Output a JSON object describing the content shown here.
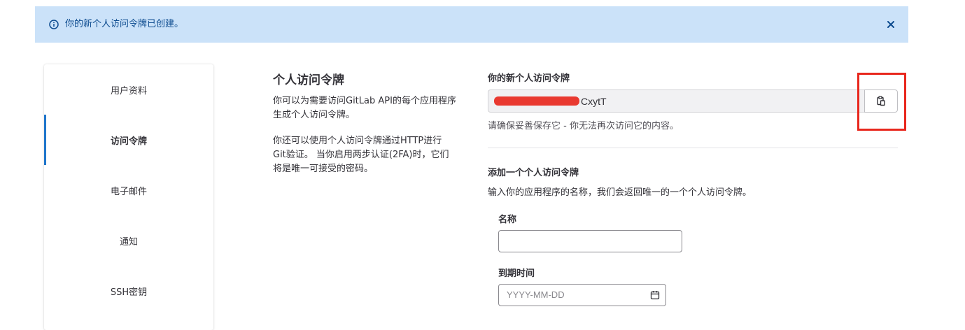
{
  "alert": {
    "message": "你的新个人访问令牌已创建。",
    "info_icon": "info-circle-icon",
    "close_icon": "close-icon",
    "background": "#cbe2f9",
    "text_color": "#0b4a8e"
  },
  "sidebar": {
    "items": [
      {
        "label": "用户资料",
        "active": false
      },
      {
        "label": "访问令牌",
        "active": true
      },
      {
        "label": "电子邮件",
        "active": false
      },
      {
        "label": "通知",
        "active": false
      },
      {
        "label": "SSH密钥",
        "active": false
      }
    ],
    "active_color": "#1f75cb"
  },
  "intro": {
    "title": "个人访问令牌",
    "paragraph1_line1": "你可以为需要访问GitLab API的每个应用程序",
    "paragraph1_line2": "生成个人访问令牌。",
    "paragraph2_line1": "你还可以使用个人访问令牌通过HTTP进行",
    "paragraph2_line2": "Git验证。 当你启用两步认证(2FA)时，它们",
    "paragraph2_line3": "将是唯一可接受的密码。"
  },
  "new_token": {
    "label": "你的新个人访问令牌",
    "visible_suffix": "CxytT",
    "copy_icon": "clipboard-icon",
    "help": "请确保妥善保存它 - 你无法再次访问它的内容。",
    "highlight_color": "#e8271d"
  },
  "add_token": {
    "title": "添加一个个人访问令牌",
    "description": "输入你的应用程序的名称，我们会返回唯一的一个个人访问令牌。",
    "name_label": "名称",
    "name_value": "",
    "expiry_label": "到期时间",
    "expiry_placeholder": "YYYY-MM-DD",
    "calendar_icon": "calendar-icon"
  }
}
